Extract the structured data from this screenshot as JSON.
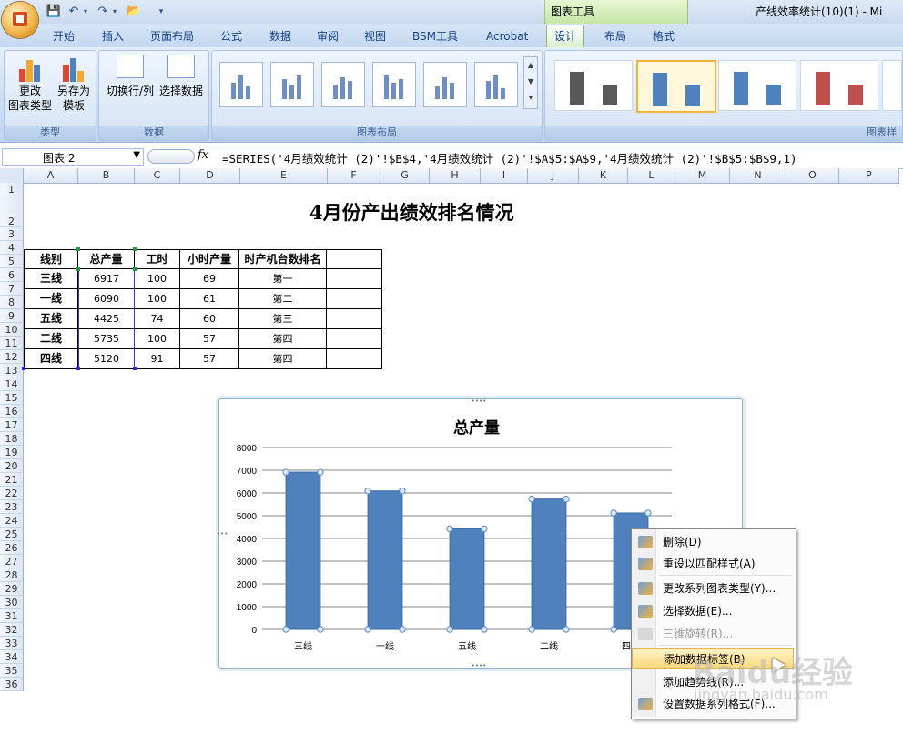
{
  "window": {
    "title": "产线效率统计(10)(1) - Mi",
    "context_tools_label": "图表工具"
  },
  "tabs": [
    "开始",
    "插入",
    "页面布局",
    "公式",
    "数据",
    "审阅",
    "视图",
    "BSM工具",
    "Acrobat",
    "设计",
    "布局",
    "格式"
  ],
  "active_tab": "设计",
  "ribbon": {
    "groups": {
      "type": {
        "label": "类型",
        "buttons": [
          {
            "line1": "更改",
            "line2": "图表类型"
          },
          {
            "line1": "另存为",
            "line2": "模板"
          }
        ]
      },
      "data": {
        "label": "数据",
        "buttons": [
          {
            "line1": "切换行/列"
          },
          {
            "line1": "选择数据"
          }
        ]
      },
      "layout": {
        "label": "图表布局"
      },
      "styles": {
        "label": "图表样"
      }
    }
  },
  "formula_bar": {
    "name_box": "图表 2",
    "fx": "fx",
    "formula": "=SERIES('4月绩效统计 (2)'!$B$4,'4月绩效统计 (2)'!$A$5:$A$9,'4月绩效统计 (2)'!$B$5:$B$9,1)"
  },
  "columns": [
    "A",
    "B",
    "C",
    "D",
    "E",
    "F",
    "G",
    "H",
    "I",
    "J",
    "K",
    "L",
    "M",
    "N",
    "O",
    "P"
  ],
  "rows": [
    "1",
    "2",
    "3",
    "4",
    "5",
    "6",
    "7",
    "8",
    "9",
    "10",
    "11",
    "12",
    "13",
    "14",
    "15",
    "16",
    "17",
    "18",
    "19",
    "20",
    "21",
    "22",
    "23",
    "24",
    "25",
    "26",
    "27",
    "28",
    "29",
    "30",
    "31",
    "32",
    "33",
    "34",
    "35",
    "36"
  ],
  "sheet": {
    "title": "4月份产出绩效排名情况",
    "headers": [
      "线别",
      "总产量",
      "工时",
      "小时产量",
      "时产机台数排名"
    ],
    "rows": [
      [
        "三线",
        "6917",
        "100",
        "69",
        "第一"
      ],
      [
        "一线",
        "6090",
        "100",
        "61",
        "第二"
      ],
      [
        "五线",
        "4425",
        "74",
        "60",
        "第三"
      ],
      [
        "二线",
        "5735",
        "100",
        "57",
        "第四"
      ],
      [
        "四线",
        "5120",
        "91",
        "57",
        "第四"
      ]
    ]
  },
  "chart_data": {
    "type": "bar",
    "title": "总产量",
    "categories": [
      "三线",
      "一线",
      "五线",
      "二线",
      "四线"
    ],
    "values": [
      6917,
      6090,
      4425,
      5735,
      5120
    ],
    "ylim": [
      0,
      8000
    ],
    "yticks": [
      "0",
      "1000",
      "2000",
      "3000",
      "4000",
      "5000",
      "6000",
      "7000",
      "8000"
    ],
    "grid": true,
    "bar_color": "#4f81bd"
  },
  "context_menu": {
    "items": [
      {
        "label": "删除(D)",
        "icon": "delete-icon",
        "disabled": false
      },
      {
        "label": "重设以匹配样式(A)",
        "icon": "reset-style-icon",
        "disabled": false
      },
      {
        "label": "更改系列图表类型(Y)...",
        "icon": "chart-type-icon",
        "disabled": false
      },
      {
        "label": "选择数据(E)...",
        "icon": "select-data-icon",
        "disabled": false
      },
      {
        "label": "三维旋转(R)...",
        "icon": "rotate-3d-icon",
        "disabled": true
      },
      {
        "label": "添加数据标签(B)",
        "icon": "",
        "disabled": false,
        "highlighted": true
      },
      {
        "label": "添加趋势线(R)...",
        "icon": "",
        "disabled": false
      },
      {
        "label": "设置数据系列格式(F)...",
        "icon": "format-series-icon",
        "disabled": false
      }
    ]
  },
  "watermark": {
    "text": "Baidu经验",
    "sub": "jingyan.baidu.com"
  }
}
